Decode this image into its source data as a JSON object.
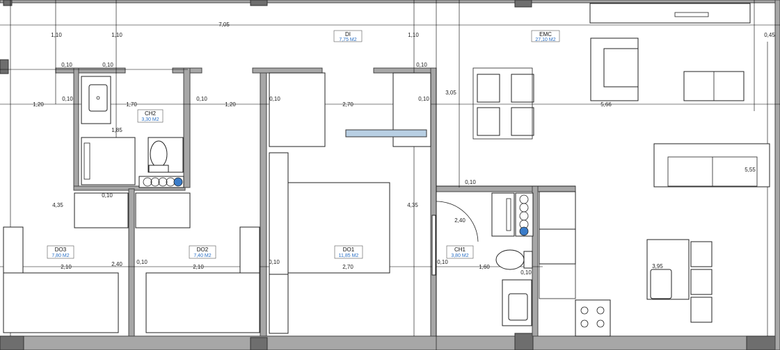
{
  "rooms": [
    {
      "name": "DI",
      "area": "7,75 M2"
    },
    {
      "name": "EMC",
      "area": "27,10 M2"
    },
    {
      "name": "CH2",
      "area": "3,30 M2"
    },
    {
      "name": "DO3",
      "area": "7,80 M2"
    },
    {
      "name": "DO2",
      "area": "7,40 M2"
    },
    {
      "name": "DO1",
      "area": "11,85 M2"
    },
    {
      "name": "CH1",
      "area": "3,80 M2"
    }
  ],
  "dimensions": {
    "overall": "7,05",
    "t1": "1,10",
    "t2": "1,10",
    "t3": "1,10",
    "t4": "0,45",
    "w1": "0,10",
    "w2": "0,10",
    "w3": "0,10",
    "r1a": "1,20",
    "r1b": "0,10",
    "r1c": "1,70",
    "r1d": "0,10",
    "r1e": "1,20",
    "r1f": "0,10",
    "r1g": "2,70",
    "r1h": "0,10",
    "r1i": "5,66",
    "v1": "3,05",
    "v2": "1,85",
    "v3": "5,55",
    "v4": "0,10",
    "v5": "0,10",
    "v6": "4,35",
    "v7": "4,35",
    "v8": "2,40",
    "b1": "2,10",
    "b2": "2,40",
    "b3": "0,10",
    "b4": "2,10",
    "b5": "0,10",
    "b6": "2,70",
    "b7": "0,10",
    "b8": "1,60",
    "b9": "3,95",
    "b10": "0,10"
  },
  "colors": {
    "wall": "#a7a7a7",
    "area_text": "#2a6fc4",
    "glass": "#b8cfe3"
  }
}
